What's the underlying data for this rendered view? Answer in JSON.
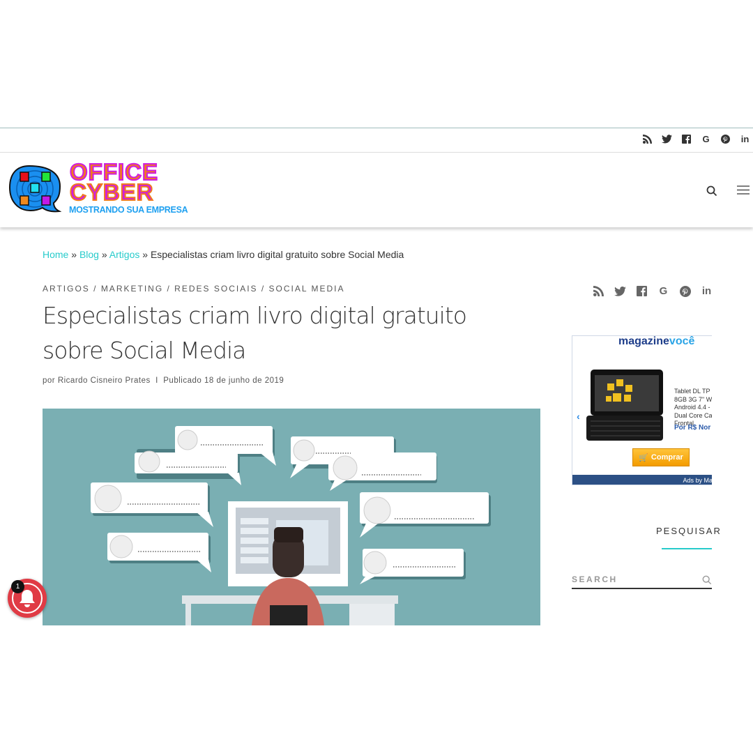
{
  "social_icons": [
    "rss-icon",
    "twitter-icon",
    "facebook-icon",
    "google-icon",
    "pinterest-icon",
    "linkedin-icon"
  ],
  "social_glyphs": {
    "rss": "◣",
    "twitter": "🐦",
    "facebook": "f",
    "google": "G",
    "pinterest": "P",
    "linkedin": "in"
  },
  "logo": {
    "line1": "OFFICE",
    "line2": "CYBER",
    "tagline": "MOSTRANDO SUA EMPRESA"
  },
  "breadcrumb": {
    "home": "Home",
    "blog": "Blog",
    "artigos": "Artigos",
    "sep": "»",
    "current": "Especialistas criam livro digital gratuito sobre Social Media"
  },
  "post": {
    "categories": [
      "ARTIGOS",
      "MARKETING",
      "REDES SOCIAIS",
      "SOCIAL MEDIA"
    ],
    "title": "Especialistas criam livro digital gratuito sobre Social Media",
    "author": "por Ricardo Cisneiro Prates",
    "published": "Publicado 18 de junho de 2019"
  },
  "ad": {
    "brand_a": "magazine",
    "brand_b": "você",
    "desc_lines": [
      "Tablet DL TP",
      "8GB 3G 7\" W",
      "Android 4.4 -",
      "Dual Core Ca",
      "Frontal"
    ],
    "price": "Por R$ Nor",
    "buy": "Comprar",
    "footer": "Ads by Ma"
  },
  "sidebar": {
    "search_heading": "PESQUISAR",
    "search_placeholder": "SEARCH"
  },
  "notification": {
    "count": "1"
  },
  "colors": {
    "accent": "#27cbcb",
    "hero_bg": "#7aafb3",
    "bell": "#e03b45"
  }
}
